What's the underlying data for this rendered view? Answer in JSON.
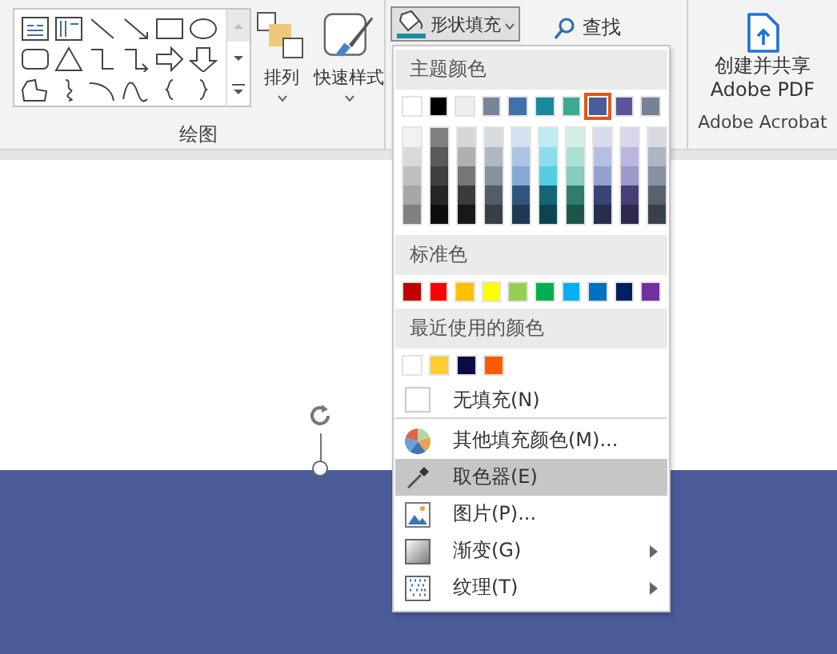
{
  "drawing_group": {
    "label": "绘图",
    "shapes": [
      {
        "kind": "text-box"
      },
      {
        "kind": "vertical-text-box"
      },
      {
        "kind": "line"
      },
      {
        "kind": "arrow"
      },
      {
        "kind": "rectangle"
      },
      {
        "kind": "oval"
      },
      {
        "kind": "rounded-rectangle"
      },
      {
        "kind": "triangle"
      },
      {
        "kind": "elbow-connector"
      },
      {
        "kind": "elbow-arrow"
      },
      {
        "kind": "right-arrow"
      },
      {
        "kind": "down-arrow"
      },
      {
        "kind": "freeform"
      },
      {
        "kind": "scribble"
      },
      {
        "kind": "arc"
      },
      {
        "kind": "curve"
      },
      {
        "kind": "left-brace"
      },
      {
        "kind": "right-brace"
      }
    ],
    "buttons": [
      {
        "kind": "arrange",
        "label": "排列"
      },
      {
        "kind": "quick-styles",
        "label": "快速样式"
      }
    ]
  },
  "shape_fill_button": {
    "label": "形状填充",
    "selected": true
  },
  "find_button": {
    "label": "查找"
  },
  "acrobat_group": {
    "button_lines": [
      "创建并共享",
      "Adobe PDF"
    ],
    "label": "Adobe Acrobat"
  },
  "menu": {
    "theme_header": "主题颜色",
    "theme_colors": [
      {
        "color": "#ffffff",
        "selected": false,
        "shades": [
          {
            "color": "#f2f2f2"
          },
          {
            "color": "#d9d9d9"
          },
          {
            "color": "#bfbfbf"
          },
          {
            "color": "#a6a6a6"
          },
          {
            "color": "#808080"
          }
        ]
      },
      {
        "color": "#000000",
        "selected": false,
        "shades": [
          {
            "color": "#7f7f7f"
          },
          {
            "color": "#595959"
          },
          {
            "color": "#404040"
          },
          {
            "color": "#262626"
          },
          {
            "color": "#0d0d0d"
          }
        ]
      },
      {
        "color": "#eeeeee",
        "selected": false,
        "shades": [
          {
            "color": "#d6d6d6"
          },
          {
            "color": "#b0b0b0"
          },
          {
            "color": "#767676"
          },
          {
            "color": "#3b3b3b"
          },
          {
            "color": "#181818"
          }
        ]
      },
      {
        "color": "#778599",
        "selected": false,
        "shades": [
          {
            "color": "#d6dbe2"
          },
          {
            "color": "#aeb7c2"
          },
          {
            "color": "#86919f"
          },
          {
            "color": "#525c6a"
          },
          {
            "color": "#373e47"
          }
        ]
      },
      {
        "color": "#3f72a8",
        "selected": false,
        "shades": [
          {
            "color": "#d4e0ef"
          },
          {
            "color": "#abc6e2"
          },
          {
            "color": "#86aad3"
          },
          {
            "color": "#2f557e"
          },
          {
            "color": "#1f3854"
          }
        ]
      },
      {
        "color": "#198a9d",
        "selected": false,
        "shades": [
          {
            "color": "#bfecf3"
          },
          {
            "color": "#8ddceb"
          },
          {
            "color": "#55cce3"
          },
          {
            "color": "#136775"
          },
          {
            "color": "#0c454e"
          }
        ]
      },
      {
        "color": "#3fa892",
        "selected": false,
        "shades": [
          {
            "color": "#d4eee8"
          },
          {
            "color": "#aadfd3"
          },
          {
            "color": "#87ccbe"
          },
          {
            "color": "#2f7e6d"
          },
          {
            "color": "#1f5449"
          }
        ]
      },
      {
        "color": "#4b5c9b",
        "selected": true,
        "shades": [
          {
            "color": "#d7dcee"
          },
          {
            "color": "#b5bfe0"
          },
          {
            "color": "#93a2cb"
          },
          {
            "color": "#384574"
          },
          {
            "color": "#262e4e"
          }
        ]
      },
      {
        "color": "#5c559c",
        "selected": false,
        "shades": [
          {
            "color": "#d8d6eb"
          },
          {
            "color": "#bab7de"
          },
          {
            "color": "#9d99c8"
          },
          {
            "color": "#443f74"
          },
          {
            "color": "#2e2a4d"
          }
        ]
      },
      {
        "color": "#778394",
        "selected": false,
        "shades": [
          {
            "color": "#d6dae0"
          },
          {
            "color": "#aeb5c0"
          },
          {
            "color": "#8692a3"
          },
          {
            "color": "#58616e"
          },
          {
            "color": "#3b4149"
          }
        ]
      }
    ],
    "standard_header": "标准色",
    "standard_colors": [
      {
        "color": "#c00000"
      },
      {
        "color": "#ff0000"
      },
      {
        "color": "#ffc000"
      },
      {
        "color": "#ffff00"
      },
      {
        "color": "#92d050"
      },
      {
        "color": "#00b050"
      },
      {
        "color": "#00b0f0"
      },
      {
        "color": "#0070c0"
      },
      {
        "color": "#002060"
      },
      {
        "color": "#7030a0"
      }
    ],
    "recent_header": "最近使用的颜色",
    "recent_colors": [
      {
        "color": "#ffffff"
      },
      {
        "color": "#ffcc33"
      },
      {
        "color": "#0c0c45"
      },
      {
        "color": "#ff5a00"
      }
    ],
    "items": [
      {
        "kind": "no-fill",
        "label": "无填充(N)",
        "selected": false,
        "has_submenu": false
      },
      {
        "kind": "more-colors",
        "label": "其他填充颜色(M)...",
        "selected": false,
        "has_submenu": false
      },
      {
        "kind": "eyedropper",
        "label": "取色器(E)",
        "selected": true,
        "has_submenu": false
      },
      {
        "kind": "picture",
        "label": "图片(P)...",
        "selected": false,
        "has_submenu": false
      },
      {
        "kind": "gradient",
        "label": "渐变(G)",
        "selected": false,
        "has_submenu": true
      },
      {
        "kind": "texture",
        "label": "纹理(T)",
        "selected": false,
        "has_submenu": true
      }
    ]
  }
}
